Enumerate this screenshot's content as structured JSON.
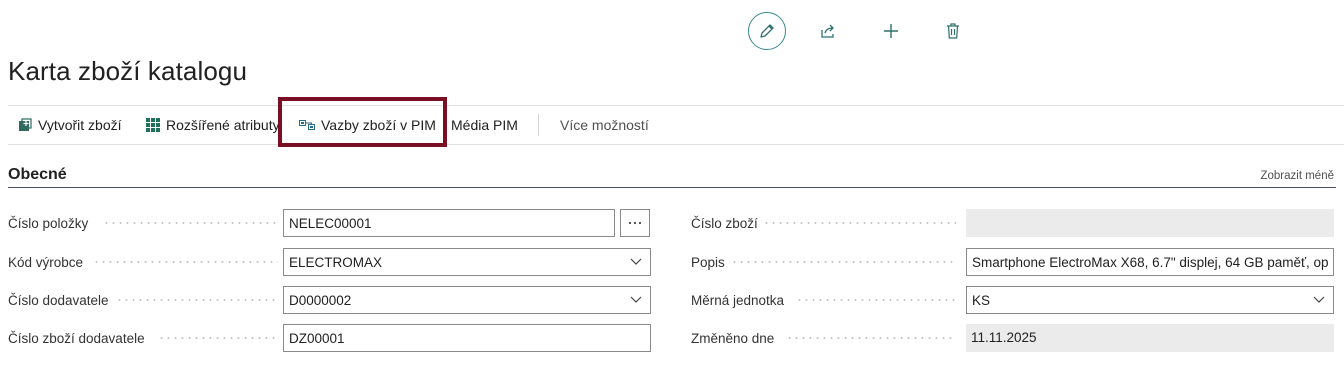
{
  "top_actions": {
    "edit_icon": "pencil-icon",
    "share_icon": "share-icon",
    "new_icon": "plus-icon",
    "delete_icon": "trash-icon"
  },
  "page": {
    "title": "Karta zboží katalogu"
  },
  "action_bar": {
    "create_item": {
      "label": "Vytvořit zboží",
      "icon": "create-item-icon"
    },
    "extended_attributes": {
      "label": "Rozšířené atributy",
      "icon": "grid-icon"
    },
    "pim_links": {
      "label": "Vazby zboží v PIM",
      "icon": "links-icon"
    },
    "pim_media": {
      "label": "Média PIM"
    },
    "more_options": {
      "label": "Více možností"
    }
  },
  "section": {
    "title": "Obecné",
    "toggle_label": "Zobrazit méně"
  },
  "fields_left": {
    "item_no": {
      "label": "Číslo položky",
      "value": "NELEC00001"
    },
    "manufacturer_code": {
      "label": "Kód výrobce",
      "value": "ELECTROMAX"
    },
    "vendor_no": {
      "label": "Číslo dodavatele",
      "value": "D0000002"
    },
    "vendor_item_no": {
      "label": "Číslo zboží dodavatele",
      "value": "DZ00001"
    }
  },
  "fields_right": {
    "item_no": {
      "label": "Číslo zboží",
      "value": ""
    },
    "description": {
      "label": "Popis",
      "value": "Smartphone ElectroMax X68, 6.7\" displej, 64 GB paměť, op"
    },
    "unit_of_measure": {
      "label": "Měrná jednotka",
      "value": "KS"
    },
    "modified_date": {
      "label": "Změněno dne",
      "value": "11.11.2025"
    }
  },
  "colors": {
    "highlight": "#7a0f24",
    "accent": "#3a8a8a",
    "readonly_bg": "#ebebeb"
  }
}
